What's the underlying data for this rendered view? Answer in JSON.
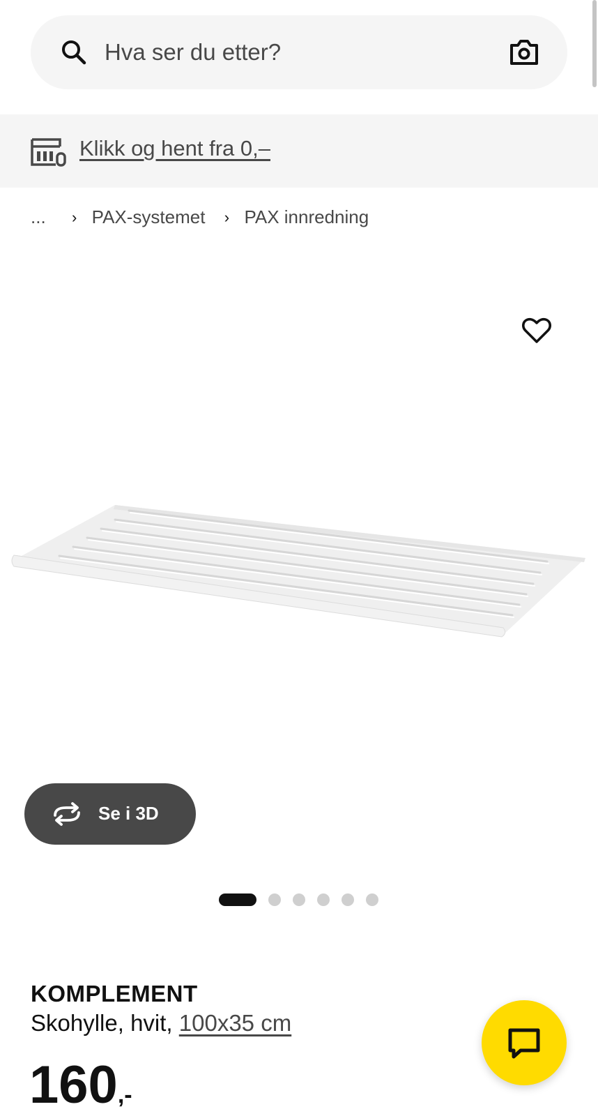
{
  "search": {
    "placeholder": "Hva ser du etter?",
    "search_icon": "search-icon",
    "camera_icon": "camera-icon"
  },
  "promo": {
    "icon": "store-pickup-icon",
    "link_text": "Klikk og hent fra 0,–"
  },
  "breadcrumb": {
    "ellipsis": "...",
    "items": [
      {
        "label": "PAX-systemet"
      },
      {
        "label": "PAX innredning"
      }
    ]
  },
  "gallery": {
    "favorite_icon": "heart-icon",
    "view_3d_label": "Se i 3D",
    "view_3d_icon": "rotate-3d-icon",
    "dot_count": 6,
    "active_index": 0
  },
  "product": {
    "name": "KOMPLEMENT",
    "description": "Skohylle, hvit,",
    "size_link": "100x35 cm",
    "price_amount": "160",
    "price_suffix": ",-"
  },
  "chat": {
    "icon": "chat-bubble-icon"
  },
  "colors": {
    "accent_yellow": "#ffdb00",
    "dark_button": "#484848",
    "light_bg": "#f5f5f5"
  }
}
